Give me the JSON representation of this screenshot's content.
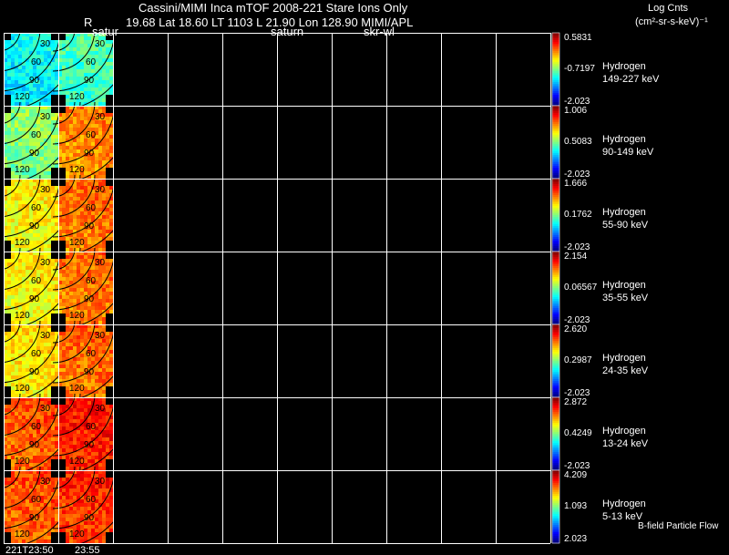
{
  "header": {
    "title": "Cassini/MIMI Inca mTOF  2008-221   Stare   Ions Only",
    "r_label": "R",
    "satur_label": "satur",
    "info_line": "19.68 Lat 18.60 LT 1103 L        21.90 Lon        128.90  MIMI/APL",
    "saturn_label": "saturn",
    "skr_label": "skr-wl",
    "units_line1": "Log Cnts",
    "units_line2": "(cm²-sr-s-keV)⁻¹"
  },
  "contour_labels": [
    "30",
    "60",
    "90",
    "120"
  ],
  "panels": [
    {
      "species": "Hydrogen",
      "energy": "149-227 keV",
      "cb_max": "0.5831",
      "cb_mid": "-0.7197",
      "cb_min": "-2.023",
      "level": [
        0.38,
        0.45
      ]
    },
    {
      "species": "Hydrogen",
      "energy": "90-149 keV",
      "cb_max": "1.006",
      "cb_mid": "0.5083",
      "cb_min": "-2.023",
      "level": [
        0.52,
        0.75
      ]
    },
    {
      "species": "Hydrogen",
      "energy": "55-90 keV",
      "cb_max": "1.666",
      "cb_mid": "0.1762",
      "cb_min": "-2.023",
      "level": [
        0.64,
        0.77
      ]
    },
    {
      "species": "Hydrogen",
      "energy": "35-55 keV",
      "cb_max": "2.154",
      "cb_mid": "0.06567",
      "cb_min": "-2.023",
      "level": [
        0.64,
        0.77
      ]
    },
    {
      "species": "Hydrogen",
      "energy": "24-35 keV",
      "cb_max": "2.620",
      "cb_mid": "0.2987",
      "cb_min": "-2.023",
      "level": [
        0.66,
        0.78
      ]
    },
    {
      "species": "Hydrogen",
      "energy": "13-24 keV",
      "cb_max": "2.872",
      "cb_mid": "0.4249",
      "cb_min": "-2.023",
      "level": [
        0.8,
        0.86
      ]
    },
    {
      "species": "Hydrogen",
      "energy": "5-13 keV",
      "cb_max": "4.209",
      "cb_mid": "1.093",
      "cb_min": "2.023",
      "level": [
        0.8,
        0.84
      ]
    }
  ],
  "footer": {
    "time1": "221T23:50",
    "time2": "23:55",
    "legend": "B-field Particle Flow"
  },
  "colors": {
    "background": "#000000",
    "grid": "#ffffff",
    "text": "#ffffff"
  },
  "chart_data": {
    "type": "heatmap",
    "title": "Cassini/MIMI Inca mTOF  2008-221   Stare   Ions Only",
    "x": [
      "221T23:50",
      "23:55"
    ],
    "rows": [
      "149-227 keV",
      "90-149 keV",
      "55-90 keV",
      "35-55 keV",
      "24-35 keV",
      "13-24 keV",
      "5-13 keV"
    ],
    "colorbar_label": "Log Cnts (cm²-sr-s-keV)⁻¹",
    "colorbar_ranges": [
      [
        -2.023,
        0.5831
      ],
      [
        -2.023,
        1.006
      ],
      [
        -2.023,
        1.666
      ],
      [
        -2.023,
        2.154
      ],
      [
        -2.023,
        2.62
      ],
      [
        -2.023,
        2.872
      ],
      [
        2.023,
        4.209
      ]
    ]
  }
}
